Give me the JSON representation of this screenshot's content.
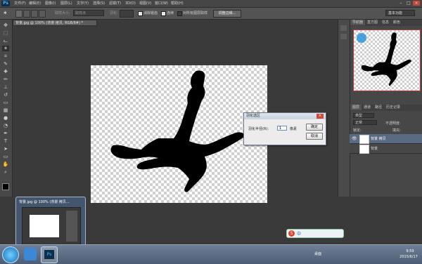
{
  "menubar": {
    "logo": "Ps",
    "items": [
      "文件(F)",
      "编辑(E)",
      "图像(I)",
      "图层(L)",
      "文字(Y)",
      "选择(S)",
      "滤镜(T)",
      "3D(D)",
      "视图(V)",
      "窗口(W)",
      "帮助(H)"
    ]
  },
  "options": {
    "feather_label": "羽化:",
    "antialias_label": "消除锯齿",
    "contiguous_label": "连续",
    "sample_all_label": "对所有图层取样",
    "refine_button": "调整边缘...",
    "workspace": "基本功能",
    "sample_size_label": "取样大小:",
    "sample_size_value": "取样点"
  },
  "document": {
    "tab_title": "背景.jpg @ 100% (背景 拷贝, RGB/8#) *"
  },
  "dialog": {
    "title": "羽化选区",
    "radius_label": "羽化半径(R):",
    "radius_value": "1",
    "unit": "像素",
    "ok_label": "确定",
    "cancel_label": "取消"
  },
  "panels": {
    "top_tabs": [
      "导航器",
      "直方图",
      "信息",
      "颜色"
    ],
    "layer_tabs": [
      "图层",
      "通道",
      "路径",
      "历史记录"
    ],
    "kind_label": "类型",
    "blend_mode": "正常",
    "opacity_label": "不透明度:",
    "fill_label": "填充:",
    "lock_label": "锁定:",
    "layers": [
      {
        "name": "背景 拷贝",
        "selected": true
      },
      {
        "name": "背景",
        "selected": false
      }
    ]
  },
  "thumbnail": {
    "title": "背景.jpg @ 100% (背景 拷贝..."
  },
  "taskbar": {
    "start_label": "",
    "lang_label": "桌面",
    "ime": "中",
    "time": "9:59",
    "date": "2015/6/17"
  },
  "colors": {
    "accent": "#1f8fd8",
    "foreground": "#000000",
    "background": "#d81e1e"
  }
}
